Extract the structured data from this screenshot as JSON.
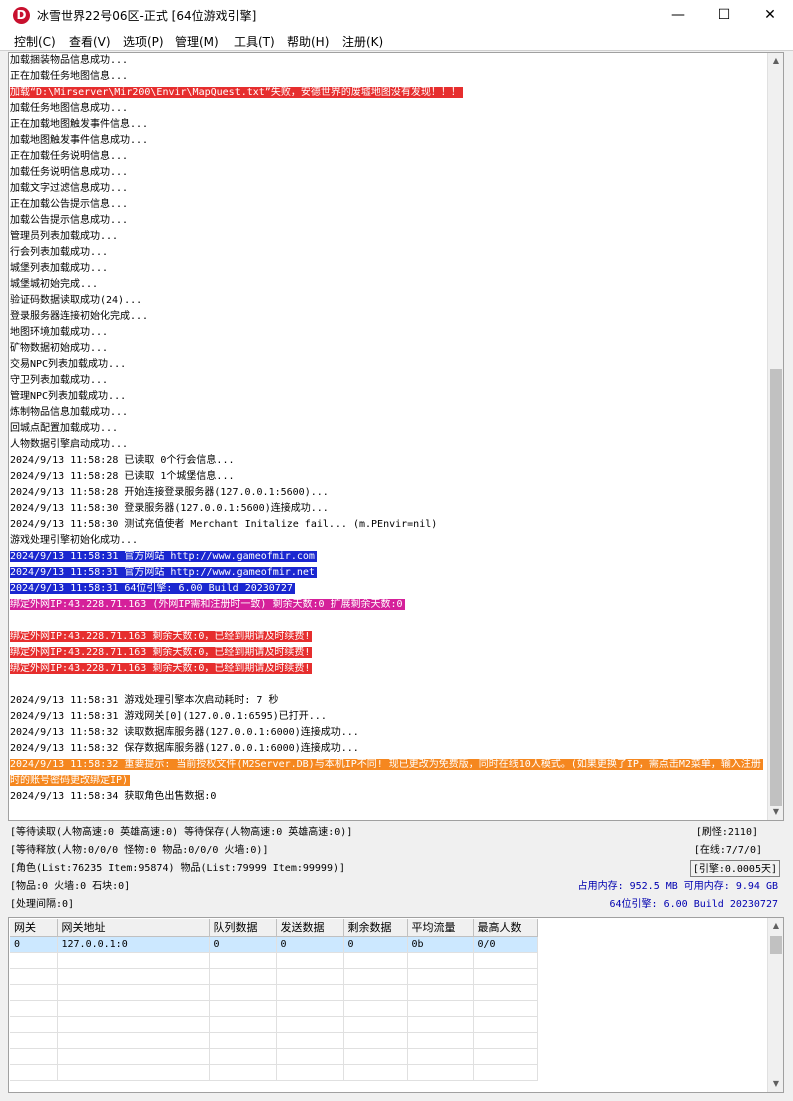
{
  "window": {
    "title": "冰雪世界22号06区-正式 [64位游戏引擎]",
    "icon_letter": "D",
    "minimize": "—",
    "maximize": "☐",
    "close": "✕"
  },
  "menu": [
    "控制(C)",
    "查看(V)",
    "选项(P)",
    "管理(M)",
    "工具(T)",
    "帮助(H)",
    "注册(K)"
  ],
  "log": [
    {
      "text": "加载捆装物品信息成功...",
      "style": ""
    },
    {
      "text": "正在加载任务地图信息...",
      "style": ""
    },
    {
      "text": "加载“D:\\Mirserver\\Mir200\\Envir\\MapQuest.txt”失败，安德世界的废墟地图没有发现！！！",
      "style": "red"
    },
    {
      "text": "加载任务地图信息成功...",
      "style": ""
    },
    {
      "text": "正在加载地图触发事件信息...",
      "style": ""
    },
    {
      "text": "加载地图触发事件信息成功...",
      "style": ""
    },
    {
      "text": "正在加载任务说明信息...",
      "style": ""
    },
    {
      "text": "加载任务说明信息成功...",
      "style": ""
    },
    {
      "text": "加载文字过滤信息成功...",
      "style": ""
    },
    {
      "text": "正在加载公告提示信息...",
      "style": ""
    },
    {
      "text": "加载公告提示信息成功...",
      "style": ""
    },
    {
      "text": "管理员列表加载成功...",
      "style": ""
    },
    {
      "text": "行会列表加载成功...",
      "style": ""
    },
    {
      "text": "城堡列表加载成功...",
      "style": ""
    },
    {
      "text": "城堡城初始完成...",
      "style": ""
    },
    {
      "text": "验证码数据读取成功(24)...",
      "style": ""
    },
    {
      "text": "登录服务器连接初始化完成...",
      "style": ""
    },
    {
      "text": "地图环境加载成功...",
      "style": ""
    },
    {
      "text": "矿物数据初始成功...",
      "style": ""
    },
    {
      "text": "交易NPC列表加载成功...",
      "style": ""
    },
    {
      "text": "守卫列表加载成功...",
      "style": ""
    },
    {
      "text": "管理NPC列表加载成功...",
      "style": ""
    },
    {
      "text": "炼制物品信息加载成功...",
      "style": ""
    },
    {
      "text": "回城点配置加载成功...",
      "style": ""
    },
    {
      "text": "人物数据引擎启动成功...",
      "style": ""
    },
    {
      "text": "2024/9/13 11:58:28 已读取 0个行会信息...",
      "style": ""
    },
    {
      "text": "2024/9/13 11:58:28 已读取 1个城堡信息...",
      "style": ""
    },
    {
      "text": "2024/9/13 11:58:28 开始连接登录服务器(127.0.0.1:5600)...",
      "style": ""
    },
    {
      "text": "2024/9/13 11:58:30 登录服务器(127.0.0.1:5600)连接成功...",
      "style": ""
    },
    {
      "text": "2024/9/13 11:58:30 测试充值使者 Merchant Initalize fail... (m.PEnvir=nil)",
      "style": ""
    },
    {
      "text": "游戏处理引擎初始化成功...",
      "style": ""
    },
    {
      "text": "2024/9/13 11:58:31 官方网站 http://www.gameofmir.com",
      "style": "blue"
    },
    {
      "text": "2024/9/13 11:58:31 官方网站 http://www.gameofmir.net",
      "style": "blue"
    },
    {
      "text": "2024/9/13 11:58:31 64位引擎: 6.00 Build 20230727",
      "style": "blue"
    },
    {
      "text": "绑定外网IP:43.228.71.163 (外网IP需和注册时一致) 剩余天数:0 扩展剩余天数:0",
      "style": "magenta"
    },
    {
      "text": "",
      "style": ""
    },
    {
      "text": "绑定外网IP:43.228.71.163 剩余天数:0，已经到期请及时续费!",
      "style": "red"
    },
    {
      "text": "绑定外网IP:43.228.71.163 剩余天数:0，已经到期请及时续费!",
      "style": "red"
    },
    {
      "text": "绑定外网IP:43.228.71.163 剩余天数:0，已经到期请及时续费!",
      "style": "red"
    },
    {
      "text": "",
      "style": ""
    },
    {
      "text": "2024/9/13 11:58:31 游戏处理引擎本次启动耗时: 7 秒",
      "style": ""
    },
    {
      "text": "2024/9/13 11:58:31 游戏网关[0](127.0.0.1:6595)已打开...",
      "style": ""
    },
    {
      "text": "2024/9/13 11:58:32 读取数据库服务器(127.0.0.1:6000)连接成功...",
      "style": ""
    },
    {
      "text": "2024/9/13 11:58:32 保存数据库服务器(127.0.0.1:6000)连接成功...",
      "style": ""
    },
    {
      "text": "2024/9/13 11:58:32 重要提示: 当前授权文件(M2Server.DB)与本机IP不同! 现已更改为免费版，同时在线10人模式。(如果更换了IP，需点击M2菜单，输入注册时的账号密码更改绑定IP)",
      "style": "orange"
    },
    {
      "text": "2024/9/13 11:58:34 获取角色出售数据:0",
      "style": ""
    }
  ],
  "status": {
    "wait_read": "[等待读取(人物高速:0 英雄高速:0) 等待保存(人物高速:0 英雄高速:0)]",
    "refresh": "[刷怪:2110]",
    "wait_release": "[等待释放(人物:0/0/0 怪物:0 物品:0/0/0 火墙:0)]",
    "online": "[在线:7/7/0]",
    "roles": "[角色(List:76235 Item:95874) 物品(List:79999 Item:99999)]",
    "engine": "[引擎:0.0005天]",
    "items": "[物品:0 火墙:0 石块:0]",
    "memory": "占用内存: 952.5 MB 可用内存: 9.94 GB",
    "interval": "[处理间隔:0]",
    "build": "64位引擎: 6.00 Build 20230727"
  },
  "gateway_table": {
    "headers": [
      "网关",
      "网关地址",
      "队列数据",
      "发送数据",
      "剩余数据",
      "平均流量",
      "最高人数"
    ],
    "rows": [
      [
        "0",
        "127.0.0.1:0",
        "0",
        "0",
        "0",
        "0b",
        "0/0"
      ]
    ]
  },
  "colors": {
    "log_red": "#e62e2e",
    "log_blue": "#1a27d0",
    "log_magenta": "#d5209a",
    "log_orange": "#f5871f",
    "status_blue": "#0000b0",
    "selected_row": "#cce8ff"
  }
}
